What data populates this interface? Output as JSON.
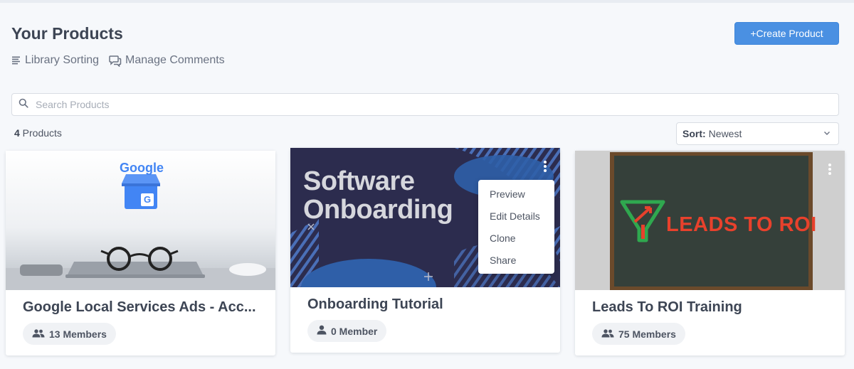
{
  "header": {
    "title": "Your Products",
    "create_button": "+Create Product",
    "links": [
      {
        "label": "Library Sorting",
        "icon": "list-icon"
      },
      {
        "label": "Manage Comments",
        "icon": "comments-icon"
      }
    ]
  },
  "search": {
    "placeholder": "Search Products",
    "value": ""
  },
  "summary": {
    "count": "4",
    "count_suffix": " Products"
  },
  "sort": {
    "label": "Sort:",
    "value": "Newest"
  },
  "products": [
    {
      "title": "Google Local Services Ads - Acc...",
      "members": "13 Members",
      "thumb_text": "Google",
      "thumb_badge": "G"
    },
    {
      "title": "Onboarding Tutorial",
      "members": "0 Member",
      "thumb_line1": "Software",
      "thumb_line2": "Onboarding"
    },
    {
      "title": "Leads To ROI Training",
      "members": "75 Members",
      "thumb_text": "LEADS TO ROI"
    }
  ],
  "context_menu": {
    "items": [
      "Preview",
      "Edit Details",
      "Clone",
      "Share"
    ]
  },
  "colors": {
    "accent": "#4a90e2",
    "background": "#f6f8fb",
    "onboarding_bg": "#2c2c4e",
    "leads_red": "#e8412c",
    "leads_green": "#2fa84f"
  }
}
